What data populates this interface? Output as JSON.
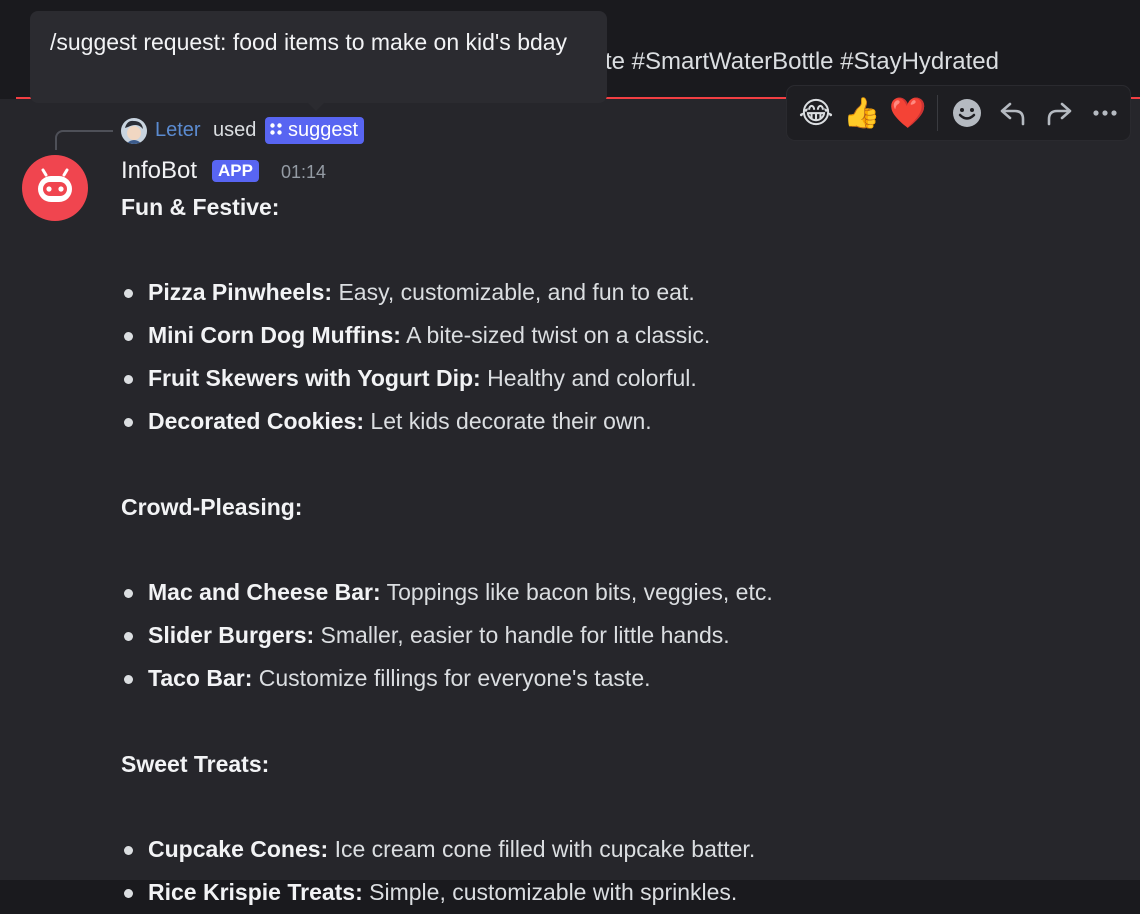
{
  "prev_message": {
    "text": "te #SmartWaterBottle #StayHydrated"
  },
  "tooltip": {
    "text": "/suggest request: food items to make on kid's bday"
  },
  "toolbar": {
    "reactions": [
      "😂",
      "👍",
      "❤️"
    ],
    "actions": [
      "add-reaction-icon",
      "reply-icon",
      "forward-icon",
      "more-icon"
    ]
  },
  "reply": {
    "user": "Leter",
    "used_text": "used",
    "command": "suggest"
  },
  "message": {
    "username": "InfoBot",
    "badge": "APP",
    "timestamp": "01:14",
    "sections": [
      {
        "heading": "Fun & Festive:",
        "items": [
          {
            "title": "Pizza Pinwheels:",
            "desc": " Easy, customizable, and fun to eat."
          },
          {
            "title": "Mini Corn Dog Muffins:",
            "desc": " A bite-sized twist on a classic."
          },
          {
            "title": "Fruit Skewers with Yogurt Dip:",
            "desc": " Healthy and colorful."
          },
          {
            "title": "Decorated Cookies:",
            "desc": " Let kids decorate their own."
          }
        ]
      },
      {
        "heading": "Crowd-Pleasing:",
        "items": [
          {
            "title": "Mac and Cheese Bar:",
            "desc": " Toppings like bacon bits, veggies, etc."
          },
          {
            "title": "Slider Burgers:",
            "desc": " Smaller, easier to handle for little hands."
          },
          {
            "title": "Taco Bar:",
            "desc": " Customize fillings for everyone's taste."
          }
        ]
      },
      {
        "heading": "Sweet Treats:",
        "items": [
          {
            "title": "Cupcake Cones:",
            "desc": " Ice cream cone filled with cupcake batter."
          },
          {
            "title": "Rice Krispie Treats:",
            "desc": " Simple, customizable with sprinkles."
          }
        ]
      }
    ]
  },
  "colors": {
    "accent": "#5865f2",
    "bot_avatar": "#f0454f",
    "new_divider": "#f23f43",
    "reply_user": "#5b8bd0"
  }
}
